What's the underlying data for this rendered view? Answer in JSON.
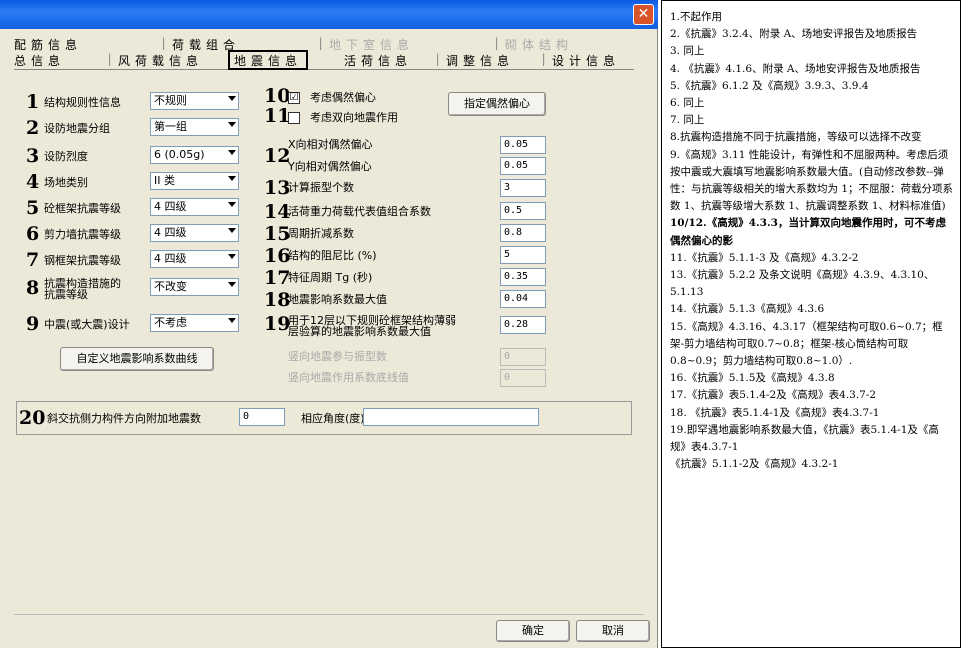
{
  "window": {
    "close_glyph": "✕"
  },
  "tabs": {
    "row1": [
      "配筋信息",
      "荷载组合",
      "地下室信息",
      "砌体结构"
    ],
    "row2": [
      "总信息",
      "风荷载信息",
      "地震信息",
      "活荷信息",
      "调整信息",
      "设计信息"
    ]
  },
  "left": [
    {
      "num": "1",
      "label": "结构规则性信息",
      "value": "不规则"
    },
    {
      "num": "2",
      "label": "设防地震分组",
      "value": "第一组"
    },
    {
      "num": "3",
      "label": "设防烈度",
      "value": "6 (0.05g)"
    },
    {
      "num": "4",
      "label": "场地类别",
      "value": "II 类"
    },
    {
      "num": "5",
      "label": "砼框架抗震等级",
      "value": "4 四级"
    },
    {
      "num": "6",
      "label": "剪力墙抗震等级",
      "value": "4 四级"
    },
    {
      "num": "7",
      "label": "钢框架抗震等级",
      "value": "4 四级"
    },
    {
      "num": "8",
      "label": "抗震构造措施的",
      "label2": "抗震等级",
      "value": "不改变"
    },
    {
      "num": "9",
      "label": "中震(或大震)设计",
      "value": "不考虑"
    }
  ],
  "custom_curve_button": "自定义地震影响系数曲线",
  "right": {
    "n10": "10",
    "n11": "11",
    "cb10": "考虑偶然偏心",
    "cb10_checked": "☑",
    "cb11": "考虑双向地震作用",
    "accidental_button": "指定偶然偏心",
    "n12": "12",
    "x_ecc": "X向相对偶然偏心",
    "x_ecc_val": "0.05",
    "y_ecc": "Y向相对偶然偏心",
    "y_ecc_val": "0.05",
    "rows": [
      {
        "num": "13",
        "label": "计算振型个数",
        "value": "3"
      },
      {
        "num": "14",
        "label": "活荷重力荷载代表值组合系数",
        "value": "0.5"
      },
      {
        "num": "15",
        "label": "周期折减系数",
        "value": "0.8"
      },
      {
        "num": "16",
        "label": "结构的阻尼比 (%)",
        "value": "5"
      },
      {
        "num": "17",
        "label": "特征周期 Tg (秒)",
        "value": "0.35"
      },
      {
        "num": "18",
        "label": "地震影响系数最大值",
        "value": "0.04"
      }
    ],
    "n19": "19",
    "r19a": "用于12层以下规则砼框架结构薄弱",
    "r19b": "层验算的地震影响系数最大值",
    "r19_val": "0.28",
    "vert1": "竖向地震参与振型数",
    "vert1_val": "0",
    "vert2": "竖向地震作用系数底线值",
    "vert2_val": "0"
  },
  "item20": {
    "num": "20",
    "label": "斜交抗侧力构件方向附加地震数",
    "value": "0",
    "angle_label": "相应角度(度)",
    "angle_value": ""
  },
  "footer": {
    "ok": "确定",
    "cancel": "取消"
  },
  "notes": [
    "1.不起作用",
    "2.《抗震》3.2.4、附录 A、场地安评报告及地质报告",
    "3. 同上",
    "4. 《抗震》4.1.6、附录 A、场地安评报告及地质报告",
    "5.《抗震》6.1.2 及《高规》3.9.3、3.9.4",
    "6. 同上",
    "7. 同上",
    "8.抗震构造措施不同于抗震措施，等级可以选择不改变",
    "9.《高规》3.11 性能设计，有弹性和不屈服两种。考虑后须按中震或大震填写地震影响系数最大值。(自动修改参数--弹性：与抗震等级相关的增大系数均为 1；不屈服：荷载分项系数 1、抗震等级增大系数 1、抗震调整系数 1、材料标准值)",
    "10/12.《高规》4.3.3，当计算双向地震作用时，可不考虑偶然偏心的影",
    "11.《抗震》5.1.1-3 及《高规》4.3.2-2",
    "13.《抗震》5.2.2 及条文说明《高规》4.3.9、4.3.10、5.1.13",
    "14.《抗震》5.1.3《高规》4.3.6",
    "15.《高规》4.3.16、4.3.17（框架结构可取0.6~0.7；框架-剪力墙结构可取0.7~0.8；框架-核心筒结构可取0.8~0.9；剪力墙结构可取0.8~1.0）.",
    "16.《抗震》5.1.5及《高规》4.3.8",
    "17.《抗震》表5.1.4-2及《高规》表4.3.7-2",
    "18. 《抗震》表5.1.4-1及《高规》表4.3.7-1",
    "19.即罕遇地震影响系数最大值，《抗震》表5.1.4-1及《高规》表4.3.7-1",
    "《抗震》5.1.1-2及《高规》4.3.2-1"
  ]
}
